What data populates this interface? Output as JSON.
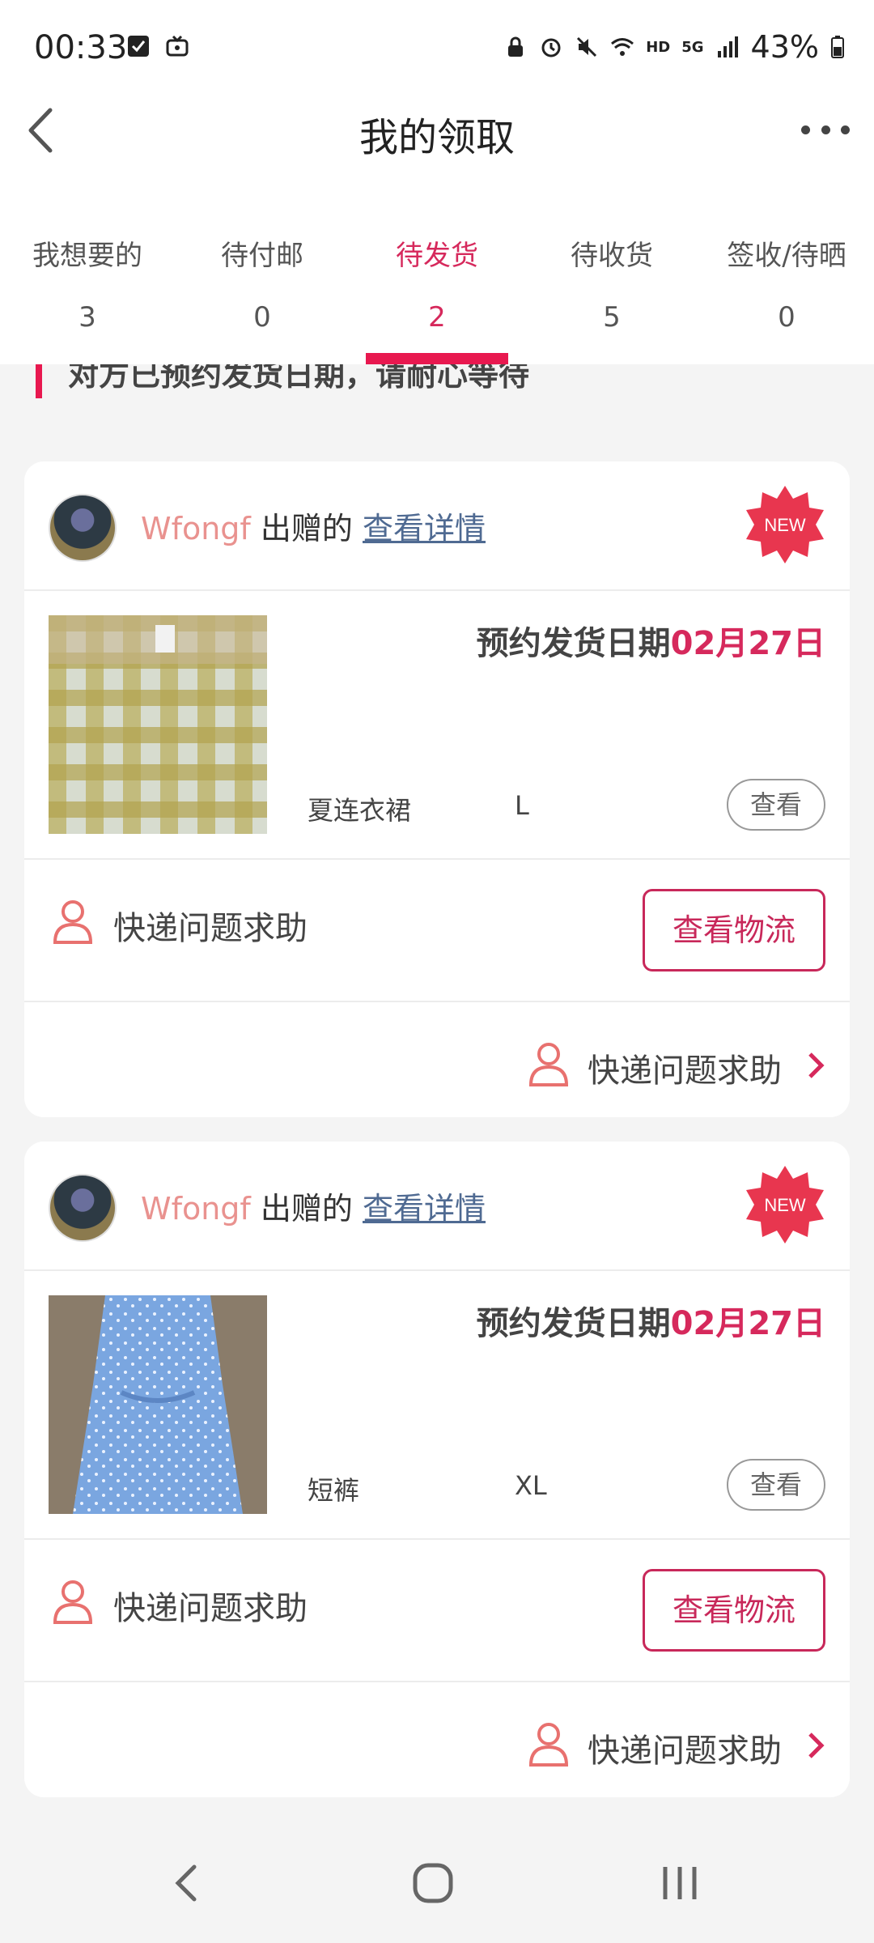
{
  "status_bar": {
    "time": "00:33",
    "battery": "43%",
    "hd": "HD",
    "net": "5G"
  },
  "header": {
    "title": "我的领取"
  },
  "tabs": [
    {
      "label": "我想要的",
      "count": "3"
    },
    {
      "label": "待付邮",
      "count": "0"
    },
    {
      "label": "待发货",
      "count": "2",
      "active": true
    },
    {
      "label": "待收货",
      "count": "5"
    },
    {
      "label": "签收/待晒",
      "count": "0"
    }
  ],
  "notice": "对方已预约发货日期，请耐心等待",
  "cards": [
    {
      "giver": "Wfongf",
      "gift_text": "出赠的",
      "detail_link": "查看详情",
      "badge": "NEW",
      "ship_label": "预约发货日期",
      "ship_date": "02月27日",
      "item_name": "夏连衣裙",
      "item_size": "L",
      "view_label": "查看",
      "help_label": "快递问题求助",
      "logistics_label": "查看物流",
      "footer_help_label": "快递问题求助"
    },
    {
      "giver": "Wfongf",
      "gift_text": "出赠的",
      "detail_link": "查看详情",
      "badge": "NEW",
      "ship_label": "预约发货日期",
      "ship_date": "02月27日",
      "item_name": "短裤",
      "item_size": "XL",
      "view_label": "查看",
      "help_label": "快递问题求助",
      "logistics_label": "查看物流",
      "footer_help_label": "快递问题求助"
    }
  ],
  "colors": {
    "accent": "#e8184f",
    "accent_text": "#d6295c",
    "giver": "#e9928f",
    "link": "#4f6a92"
  }
}
